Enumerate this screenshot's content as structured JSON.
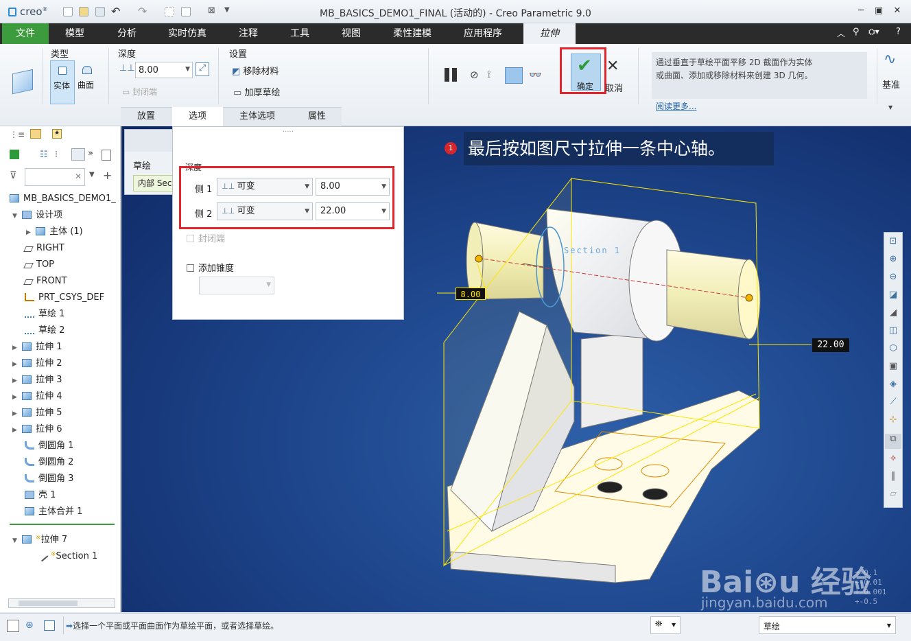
{
  "app": {
    "logo": "creo",
    "window_title": "MB_BASICS_DEMO1_FINAL (活动的) - Creo Parametric 9.0"
  },
  "ribbon_tabs": [
    "文件",
    "模型",
    "分析",
    "实时仿真",
    "注释",
    "工具",
    "视图",
    "柔性建模",
    "应用程序",
    "拉伸"
  ],
  "ribbon": {
    "type_group": {
      "label": "类型",
      "solid": "实体",
      "surface": "曲面"
    },
    "depth_group": {
      "label": "深度",
      "value": "8.00",
      "capped": "封闭端"
    },
    "settings_group": {
      "label": "设置",
      "remove_material": "移除材料",
      "thicken_sketch": "加厚草绘"
    },
    "confirm": "确定",
    "cancel": "取消",
    "help_text": "通过垂直于草绘平面平移 2D 截面作为实体或曲面、添加或移除材料来创建 3D 几何。",
    "read_more": "阅读更多...",
    "datum": "基准",
    "subtabs": [
      "放置",
      "选项",
      "主体选项",
      "属性"
    ]
  },
  "placement_panel": {
    "label": "草绘",
    "value": "内部 Sec"
  },
  "options_popup": {
    "depth_label": "深度",
    "side1": {
      "label": "侧 1",
      "type": "可变",
      "value": "8.00"
    },
    "side2": {
      "label": "侧 2",
      "type": "可变",
      "value": "22.00"
    },
    "capped_ends": "封闭端",
    "add_taper": "添加锥度"
  },
  "model_tree": {
    "root": "MB_BASICS_DEMO1_",
    "items": [
      {
        "label": "设计项",
        "icon": "design-items-icon"
      },
      {
        "label": "主体 (1)",
        "icon": "body-icon"
      },
      {
        "label": "RIGHT",
        "icon": "datum-plane-icon"
      },
      {
        "label": "TOP",
        "icon": "datum-plane-icon"
      },
      {
        "label": "FRONT",
        "icon": "datum-plane-icon"
      },
      {
        "label": "PRT_CSYS_DEF",
        "icon": "csys-icon"
      },
      {
        "label": "草绘 1",
        "icon": "sketch-icon"
      },
      {
        "label": "草绘 2",
        "icon": "sketch-icon"
      },
      {
        "label": "拉伸 1",
        "icon": "extrude-icon"
      },
      {
        "label": "拉伸 2",
        "icon": "extrude-icon"
      },
      {
        "label": "拉伸 3",
        "icon": "extrude-icon"
      },
      {
        "label": "拉伸 4",
        "icon": "extrude-icon"
      },
      {
        "label": "拉伸 5",
        "icon": "extrude-icon"
      },
      {
        "label": "拉伸 6",
        "icon": "extrude-icon"
      },
      {
        "label": "倒圆角 1",
        "icon": "round-icon"
      },
      {
        "label": "倒圆角 2",
        "icon": "round-icon"
      },
      {
        "label": "倒圆角 3",
        "icon": "round-icon"
      },
      {
        "label": "壳 1",
        "icon": "shell-icon"
      },
      {
        "label": "主体合并 1",
        "icon": "body-merge-icon"
      },
      {
        "label": "拉伸 7",
        "icon": "extrude-icon"
      },
      {
        "label": "Section 1",
        "icon": "section-icon"
      }
    ]
  },
  "viewport": {
    "callout_number": "1",
    "callout_text": "最后按如图尺寸拉伸一条中心轴。",
    "dim1": "8.00",
    "dim2": "22.00",
    "section_label": "Section 1",
    "watermark_lines": [
      "+-0.1",
      "+-0.01",
      "+-0.001",
      "+-0.5"
    ],
    "watermark_site": "jingyan.baidu.com"
  },
  "status": {
    "message": "选择一个平面或平面曲面作为草绘平面，或者选择草绘。",
    "filter": "草绘"
  }
}
